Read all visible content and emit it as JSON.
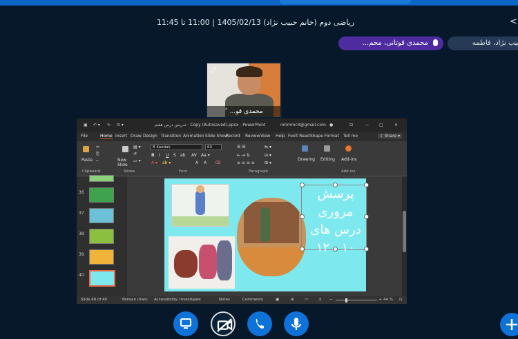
{
  "header": {
    "title": "ریاضی دوم (خانم حبیب نژاد) 1405/02/13 | 11:00 تا 11:45",
    "menu_glyph": "<"
  },
  "talking": {
    "speaker_chip": "محمدی قوتانی، محم...",
    "user_chip": "حبیب نژاد، فاطمه"
  },
  "webcam": {
    "name": "محمدی قو...",
    "expand_icon": "expand-icon"
  },
  "powerpoint": {
    "doc_title": "تدریس درس هفتم - Copy (Autosaved).ppsx - PowerPoint",
    "account_email": "nmmmc4@gmail.com",
    "tabs": [
      "File",
      "Home",
      "Insert",
      "Draw",
      "Design",
      "Transition",
      "Animation",
      "Slide Show",
      "Record",
      "Review",
      "View",
      "Help",
      "Foxit Read",
      "Shape Format",
      "Tell me"
    ],
    "active_tab": "Home",
    "share_label": "Share",
    "ribbon": {
      "paste": "Paste",
      "new_slide": "New Slide",
      "font_name": "B Koodak",
      "font_size": "60",
      "drawing": "Drawing",
      "editing": "Editing",
      "addins": "Add-ins",
      "groups": [
        "Clipboard",
        "Slides",
        "Font",
        "Paragraph",
        "Add-ins"
      ]
    },
    "thumbnails": [
      {
        "num": "36",
        "color": "#3fa34d"
      },
      {
        "num": "37",
        "color": "#6cc0d8"
      },
      {
        "num": "38",
        "color": "#8bbf3f"
      },
      {
        "num": "39",
        "color": "#f0b43a"
      },
      {
        "num": "40",
        "color": "#7de9ee"
      }
    ],
    "selected_slide": "40",
    "slide_text": [
      "پرسش",
      "مروری",
      "درس های",
      "۱۰ - ۱۲"
    ],
    "status": {
      "slide_count": "Slide 40 of 40",
      "language": "Persian (Iran)",
      "accessibility": "Accessibility: Investigate",
      "notes": "Notes",
      "comments": "Comments",
      "zoom": "44 %"
    }
  },
  "controls": [
    "screen-share-icon",
    "camera-off-icon",
    "phone-icon",
    "microphone-icon"
  ],
  "colors": {
    "background": "#06182a",
    "accent": "#0e72d8",
    "speaker_chip": "#4e2ca0",
    "slide_bg": "#7de9ee"
  }
}
